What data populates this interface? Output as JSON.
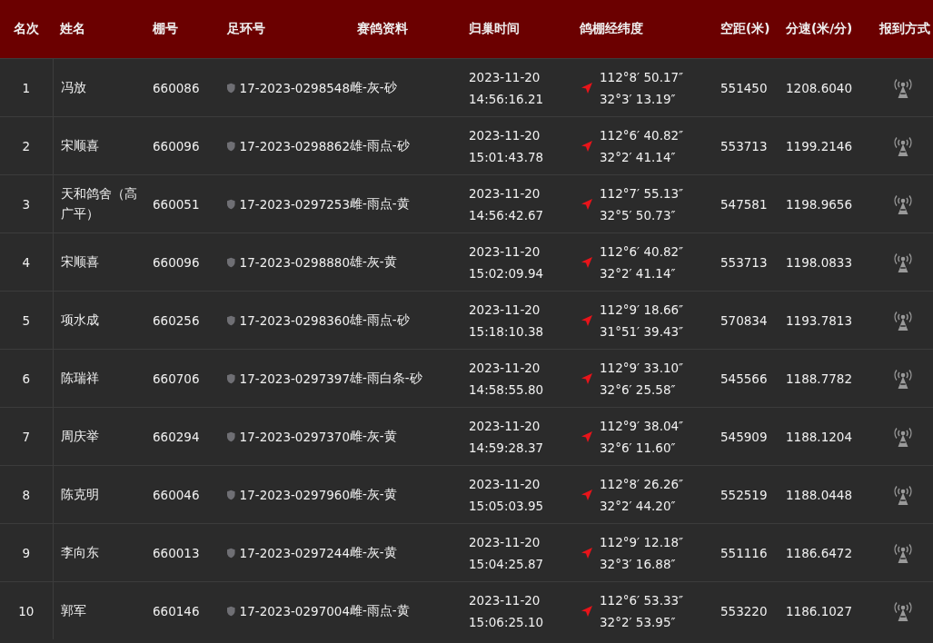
{
  "table": {
    "columns": [
      "名次",
      "姓名",
      "棚号",
      "足环号",
      "赛鸽资料",
      "归巢时间",
      "鸽棚经纬度",
      "空距(米)",
      "分速(米/分)",
      "报到方式"
    ],
    "rows": [
      {
        "rank": "1",
        "name": "冯放",
        "loft": "660086",
        "ring": "17-2023-0298548",
        "info": "雌-灰-砂",
        "date": "2023-11-20",
        "time": "14:56:16.21",
        "lon": "112°8′  50.17″",
        "lat": "32°3′  13.19″",
        "distance": "551450",
        "speed": "1208.6040"
      },
      {
        "rank": "2",
        "name": "宋顺喜",
        "loft": "660096",
        "ring": "17-2023-0298862",
        "info": "雄-雨点-砂",
        "date": "2023-11-20",
        "time": "15:01:43.78",
        "lon": "112°6′  40.82″",
        "lat": "32°2′  41.14″",
        "distance": "553713",
        "speed": "1199.2146"
      },
      {
        "rank": "3",
        "name": "天和鸽舍（高广平）",
        "loft": "660051",
        "ring": "17-2023-0297253",
        "info": "雌-雨点-黄",
        "date": "2023-11-20",
        "time": "14:56:42.67",
        "lon": "112°7′  55.13″",
        "lat": "32°5′  50.73″",
        "distance": "547581",
        "speed": "1198.9656"
      },
      {
        "rank": "4",
        "name": "宋顺喜",
        "loft": "660096",
        "ring": "17-2023-0298880",
        "info": "雄-灰-黄",
        "date": "2023-11-20",
        "time": "15:02:09.94",
        "lon": "112°6′  40.82″",
        "lat": "32°2′  41.14″",
        "distance": "553713",
        "speed": "1198.0833"
      },
      {
        "rank": "5",
        "name": "项水成",
        "loft": "660256",
        "ring": "17-2023-0298360",
        "info": "雄-雨点-砂",
        "date": "2023-11-20",
        "time": "15:18:10.38",
        "lon": "112°9′  18.66″",
        "lat": "31°51′  39.43″",
        "distance": "570834",
        "speed": "1193.7813"
      },
      {
        "rank": "6",
        "name": "陈瑞祥",
        "loft": "660706",
        "ring": "17-2023-0297397",
        "info": "雄-雨白条-砂",
        "date": "2023-11-20",
        "time": "14:58:55.80",
        "lon": "112°9′  33.10″",
        "lat": "32°6′  25.58″",
        "distance": "545566",
        "speed": "1188.7782"
      },
      {
        "rank": "7",
        "name": "周庆举",
        "loft": "660294",
        "ring": "17-2023-0297370",
        "info": "雌-灰-黄",
        "date": "2023-11-20",
        "time": "14:59:28.37",
        "lon": "112°9′  38.04″",
        "lat": "32°6′  11.60″",
        "distance": "545909",
        "speed": "1188.1204"
      },
      {
        "rank": "8",
        "name": "陈克明",
        "loft": "660046",
        "ring": "17-2023-0297960",
        "info": "雌-灰-黄",
        "date": "2023-11-20",
        "time": "15:05:03.95",
        "lon": "112°8′  26.26″",
        "lat": "32°2′  44.20″",
        "distance": "552519",
        "speed": "1188.0448"
      },
      {
        "rank": "9",
        "name": "李向东",
        "loft": "660013",
        "ring": "17-2023-0297244",
        "info": "雌-灰-黄",
        "date": "2023-11-20",
        "time": "15:04:25.87",
        "lon": "112°9′  12.18″",
        "lat": "32°3′  16.88″",
        "distance": "551116",
        "speed": "1186.6472"
      },
      {
        "rank": "10",
        "name": "郭军",
        "loft": "660146",
        "ring": "17-2023-0297004",
        "info": "雌-雨点-黄",
        "date": "2023-11-20",
        "time": "15:06:25.10",
        "lon": "112°6′  53.33″",
        "lat": "32°2′  53.95″",
        "distance": "553220",
        "speed": "1186.1027"
      }
    ]
  }
}
